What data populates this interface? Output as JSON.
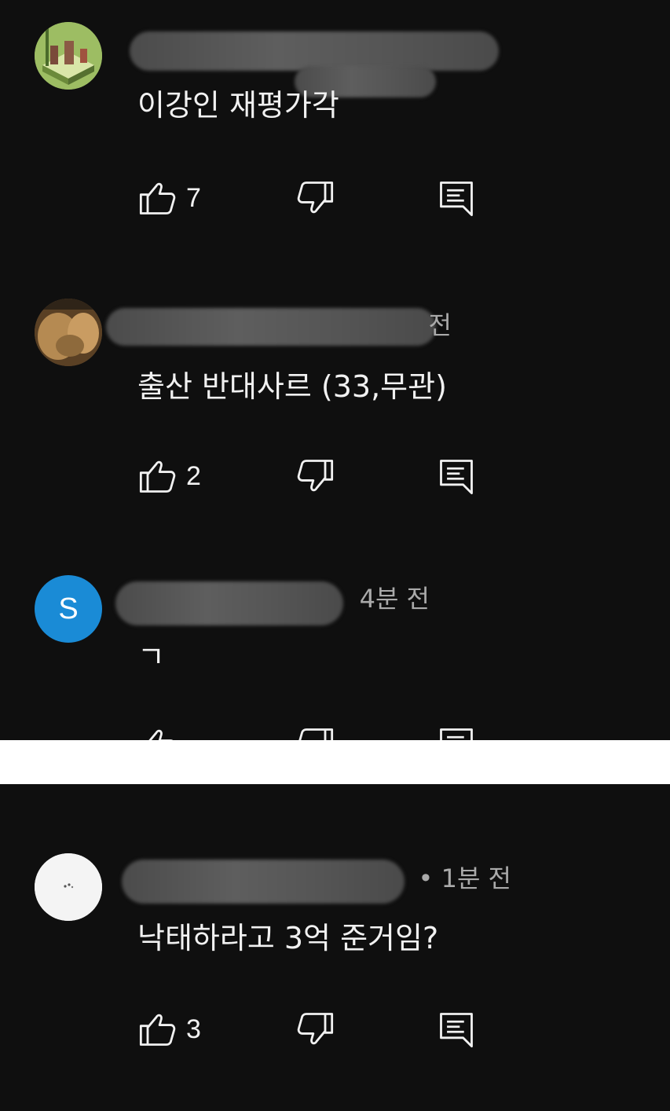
{
  "comments_top": [
    {
      "avatar_type": "image-green-tower",
      "time": "",
      "text": "이강인 재평가각",
      "likes": "7"
    },
    {
      "avatar_type": "image-brown-photo",
      "time": "전",
      "text": "출산 반대사르 (33,무관)",
      "likes": "2"
    },
    {
      "avatar_type": "letter",
      "avatar_letter": "S",
      "avatar_color": "#1a8bd6",
      "time": "4분 전",
      "text": "ㄱ",
      "likes": ""
    }
  ],
  "comments_bottom": [
    {
      "avatar_type": "image-white",
      "time": "• 1분 전",
      "text": "낙태하라고 3억 준거임?",
      "likes": "3"
    }
  ],
  "icons": {
    "like": "thumbs-up-icon",
    "dislike": "thumbs-down-icon",
    "reply": "reply-comment-icon"
  },
  "colors": {
    "background": "#0f0f0f",
    "text": "#f1f1f1",
    "meta": "#aaaaaa"
  }
}
